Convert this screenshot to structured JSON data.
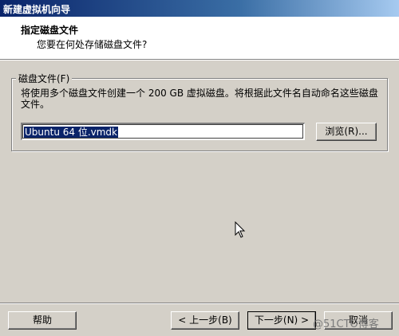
{
  "window": {
    "title": "新建虚拟机向导"
  },
  "header": {
    "title": "指定磁盘文件",
    "subtitle": "您要在何处存储磁盘文件?"
  },
  "group": {
    "legend": "磁盘文件(F)",
    "description": "将使用多个磁盘文件创建一个 200 GB 虚拟磁盘。将根据此文件名自动命名这些磁盘文件。",
    "file_value": "Ubuntu 64 位.vmdk",
    "browse_label": "浏览(R)..."
  },
  "footer": {
    "help_label": "帮助",
    "back_label": "< 上一步(B)",
    "next_label": "下一步(N) >",
    "cancel_label": "取消"
  },
  "watermark": "@51CTO博客",
  "icons": {
    "cursor": "mouse-pointer-icon"
  }
}
